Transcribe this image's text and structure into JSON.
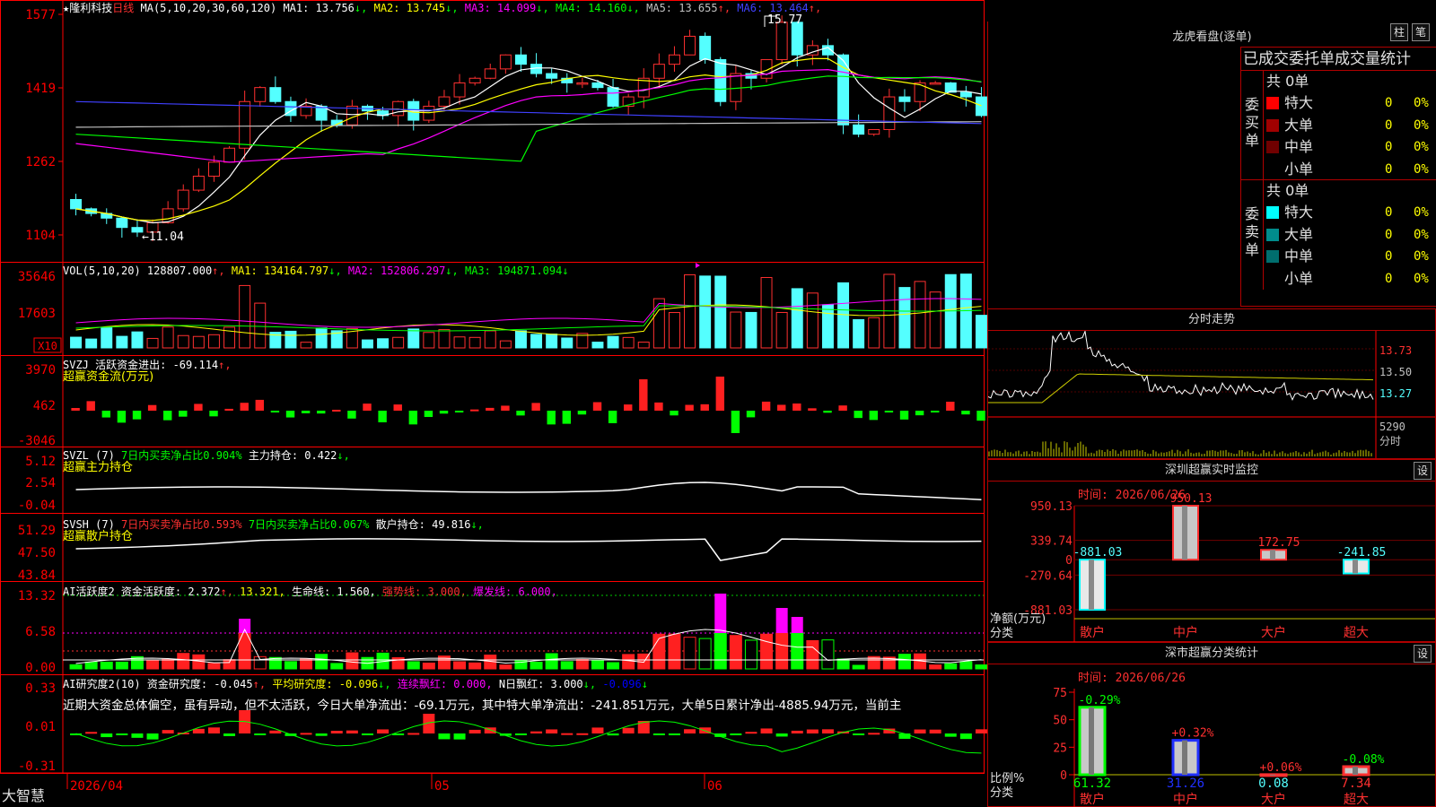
{
  "stock": {
    "name": "隆利科技",
    "period": "日线",
    "star_icon": "star-icon",
    "ma_label": "MA(5,10,20,30,60,120)",
    "ma_values": [
      {
        "label": "MA1: 13.756",
        "color": "#ffffff",
        "arrow": "↓"
      },
      {
        "label": "MA2: 13.745",
        "color": "#ffff00",
        "arrow": "↓"
      },
      {
        "label": "MA3: 14.099",
        "color": "#ff00ff",
        "arrow": "↓"
      },
      {
        "label": "MA4: 14.160",
        "color": "#00ff00",
        "arrow": "↓"
      },
      {
        "label": "MA5: 13.655",
        "color": "#c0c0c0",
        "arrow": "↑"
      },
      {
        "label": "MA6: 13.464",
        "color": "#4040ff",
        "arrow": "↑"
      }
    ],
    "price_axis": [
      "1577",
      "1419",
      "1262",
      "1104"
    ],
    "high_mark": "15.77",
    "low_mark": "11.04"
  },
  "vol": {
    "label": "VOL(5,10,20)",
    "value": "128807.000",
    "ma1": "MA1: 134164.797",
    "ma2": "MA2: 152806.297",
    "ma3": "MA3: 194871.094",
    "axis": [
      "35646",
      "17603"
    ],
    "unit": "X10"
  },
  "svzj": {
    "label": "SVZJ",
    "name": "活跃资金进出: -69.114",
    "subtitle": "超赢资金流(万元)",
    "axis": [
      "3970",
      "462",
      "-3046"
    ]
  },
  "svzl": {
    "label": "SVZL (7)",
    "text1": "7日内买卖净占比0.904%",
    "text2": "主力持仓: 0.422",
    "subtitle": "超赢主力持仓",
    "axis": [
      "5.12",
      "2.54",
      "-0.04"
    ]
  },
  "svsh": {
    "label": "SVSH (7)",
    "text1": "7日内买卖净占比0.593%",
    "text2": "7日内买卖净占比0.067%",
    "text3": "散户持仓: 49.816",
    "subtitle": "超赢散户持仓",
    "axis": [
      "51.29",
      "47.50",
      "43.84"
    ]
  },
  "ai_active": {
    "label": "AI活跃度2",
    "t1": "资金活跃度: 2.372",
    "t2": "13.321,",
    "t3": "生命线: 1.560,",
    "t4": "强势线: 3.000,",
    "t5": "爆发线: 6.000,",
    "axis": [
      "13.32",
      "6.58",
      "0.00"
    ]
  },
  "ai_research": {
    "label": "AI研究度2(10)",
    "t1": "资金研究度: -0.045",
    "t2": "平均研究度: -0.096",
    "t3": "连续飘红: 0.000,",
    "t4": "N日飘红: 3.000",
    "t5": "-0.096",
    "commentary": "近期大资金总体偏空，虽有异动，但不太活跃，今日大单净流出：-69.1万元，其中特大单净流出：-241.851万元，大单5日累计净出-4885.94万元，当前主",
    "axis": [
      "0.33",
      "0.01",
      "-0.31"
    ]
  },
  "time_axis": [
    "2026/04",
    "05",
    "06"
  ],
  "status_bar": {
    "brand": "大智慧"
  },
  "dragon": {
    "title": "龙虎看盘(逐单)",
    "btn_bar": "柱",
    "btn_pen": "笔",
    "header": "已成交委托单成交量统计",
    "buy_label": "委买单",
    "sell_label": "委卖单",
    "buy_total": "共 0单",
    "sell_total": "共 0单",
    "buy_rows": [
      {
        "name": "特大",
        "color": "#ff0000",
        "count": "0",
        "pct": "0%"
      },
      {
        "name": "大单",
        "color": "#a00000",
        "count": "0",
        "pct": "0%"
      },
      {
        "name": "中单",
        "color": "#700000",
        "count": "0",
        "pct": "0%"
      },
      {
        "name": "小单",
        "color": "",
        "count": "0",
        "pct": "0%"
      }
    ],
    "sell_rows": [
      {
        "name": "特大",
        "color": "#00ffff",
        "count": "0",
        "pct": "0%"
      },
      {
        "name": "大单",
        "color": "#008c8c",
        "count": "0",
        "pct": "0%"
      },
      {
        "name": "中单",
        "color": "#006e6e",
        "count": "0",
        "pct": "0%"
      },
      {
        "name": "小单",
        "color": "",
        "count": "0",
        "pct": "0%"
      }
    ]
  },
  "intraday": {
    "title": "分时走势",
    "axis": [
      "13.73",
      "13.50",
      "13.27"
    ],
    "vol_label": "5290",
    "unit": "分时"
  },
  "sz_monitor": {
    "title": "深圳超赢实时监控",
    "btn": "设",
    "time": "时间: 2026/06/26",
    "axis": [
      "950.13",
      "339.74",
      "0",
      "-270.64",
      "-881.03"
    ],
    "axis_label": "净额(万元)",
    "cat_label": "分类",
    "categories": [
      "散户",
      "中户",
      "大户",
      "超大"
    ],
    "bar_values": [
      "-881.03",
      "950.13",
      "172.75",
      "-241.85"
    ]
  },
  "sz_class": {
    "title": "深市超赢分类统计",
    "btn": "设",
    "time": "时间: 2026/06/26",
    "axis": [
      "75",
      "50",
      "25",
      "0"
    ],
    "axis_label": "比例%",
    "cat_label": "分类",
    "categories": [
      "散户",
      "中户",
      "大户",
      "超大"
    ],
    "top_labels": [
      "-0.29%",
      "+0.32%",
      "+0.06%",
      "-0.08%"
    ],
    "bottom_values": [
      "61.32",
      "31.26",
      "0.08",
      "7.34"
    ]
  },
  "chart_data": [
    {
      "type": "bar",
      "title": "深圳超赢实时监控",
      "ylabel": "净额(万元)",
      "categories": [
        "散户",
        "中户",
        "大户",
        "超大"
      ],
      "values": [
        -881.03,
        950.13,
        172.75,
        -241.85
      ],
      "ylim": [
        -881.03,
        950.13
      ]
    },
    {
      "type": "bar",
      "title": "深市超赢分类统计",
      "ylabel": "比例%",
      "categories": [
        "散户",
        "中户",
        "大户",
        "超大"
      ],
      "values": [
        61.32,
        31.26,
        0.08,
        7.34
      ],
      "ylim": [
        0,
        75
      ]
    }
  ]
}
